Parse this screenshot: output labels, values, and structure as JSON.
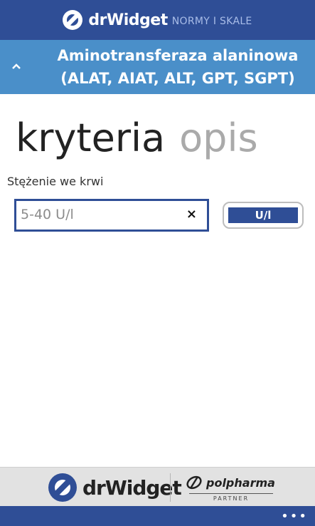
{
  "header": {
    "brand": "drWidget",
    "subtitle": "NORMY I SKALE",
    "logo_icon": "drwidget-logo-icon"
  },
  "title": {
    "text": "Aminotransferaza alaninowa (ALAT, AIAT, ALT, GPT, SGPT)",
    "collapse_icon": "chevron-up-icon"
  },
  "pivot": {
    "active": "kryteria",
    "inactive": "opis"
  },
  "field": {
    "label": "Stężenie we krwi",
    "placeholder": "5-40 U/l",
    "clear_symbol": "×",
    "unit_label": "U/l"
  },
  "footer": {
    "brand": "drWidget",
    "partner_name": "polpharma",
    "partner_caption": "PARTNER"
  },
  "appbar": {
    "more_symbol": "•••"
  },
  "colors": {
    "primary": "#2f4e96",
    "title_bar": "#4a8fc9",
    "footer_bg": "#e2e2e2"
  }
}
